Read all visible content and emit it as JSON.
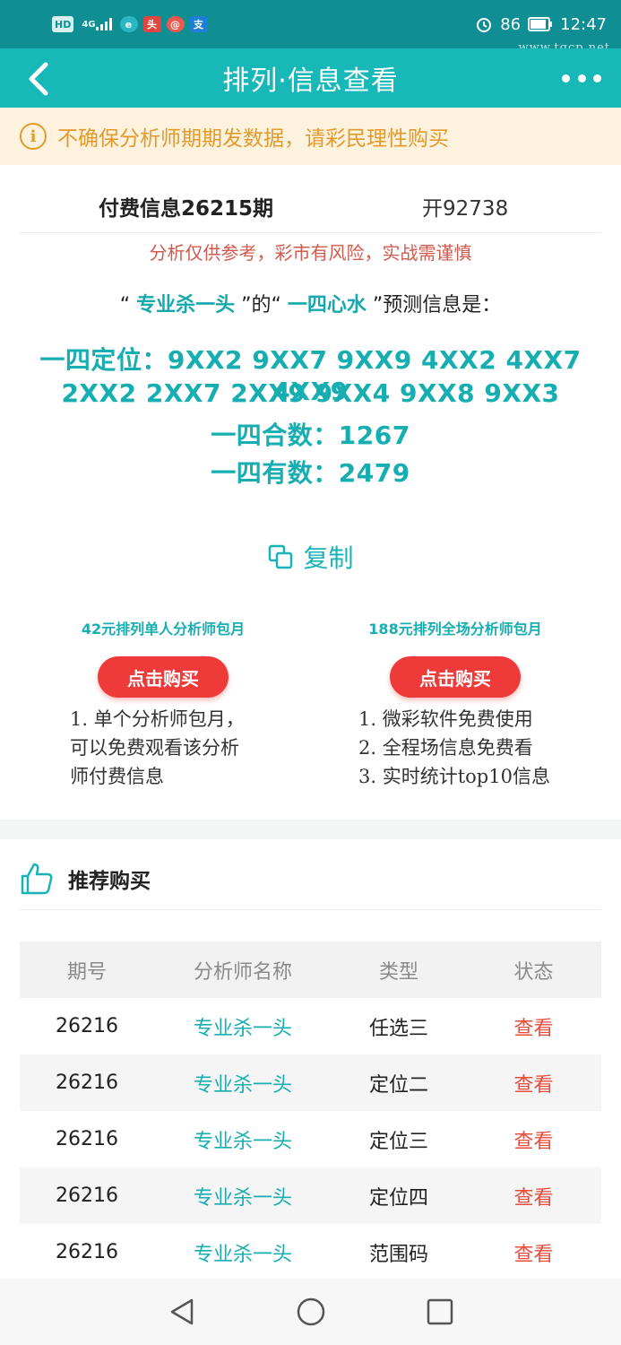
{
  "status_bar": {
    "chips": [
      "HD",
      "4G",
      "",
      "",
      "",
      "支"
    ],
    "battery": "86",
    "time": "12:47"
  },
  "watermark": "www.tqcp.net",
  "nav": {
    "title": "排列·信息查看"
  },
  "notice": {
    "icon": "i",
    "text": "不确保分析师期期发数据，请彩民理性购买"
  },
  "info": {
    "title": "付费信息26215期",
    "open": "开92738",
    "disclaimer": "分析仅供参考，彩市有风险，实战需谨慎",
    "predict": {
      "quote_open_1": "“ ",
      "analyst": "专业杀一头",
      "mid": " ”的“ ",
      "type": "一四心水",
      "tail": " ”预测信息是："
    },
    "rows": [
      "一四定位：9XX2 9XX7 9XX9 4XX2 4XX7 4XX9",
      "2XX2 2XX7 2XX9 9XX4 9XX8 9XX3",
      "一四合数：1267",
      "一四有数：2479"
    ],
    "copy_label": "复制"
  },
  "packages": [
    {
      "title": "42元排列单人分析师包月",
      "button": "点击购买",
      "lines": [
        "1. 单个分析师包月，",
        "可以免费观看该分析",
        "师付费信息"
      ]
    },
    {
      "title": "188元排列全场分析师包月",
      "button": "点击购买",
      "lines": [
        "1. 微彩软件免费使用",
        "2. 全程场信息免费看",
        "3. 实时统计top10信息"
      ]
    }
  ],
  "recommend": {
    "title": "推荐购买",
    "headers": [
      "期号",
      "分析师名称",
      "类型",
      "状态"
    ],
    "rows": [
      {
        "period": "26216",
        "analyst": "专业杀一头",
        "type": "任选三",
        "status": "查看"
      },
      {
        "period": "26216",
        "analyst": "专业杀一头",
        "type": "定位二",
        "status": "查看"
      },
      {
        "period": "26216",
        "analyst": "专业杀一头",
        "type": "定位三",
        "status": "查看"
      },
      {
        "period": "26216",
        "analyst": "专业杀一头",
        "type": "定位四",
        "status": "查看"
      },
      {
        "period": "26216",
        "analyst": "专业杀一头",
        "type": "范围码",
        "status": "查看"
      }
    ]
  },
  "colors": {
    "nav": "#18b7b8",
    "status_bar": "#0f8f93",
    "accent": "#16aeb1",
    "buy": "#ee3b3a",
    "notice_bg": "#fcf2dd",
    "notice_text": "#e39a2c",
    "view": "#e84c3d"
  }
}
